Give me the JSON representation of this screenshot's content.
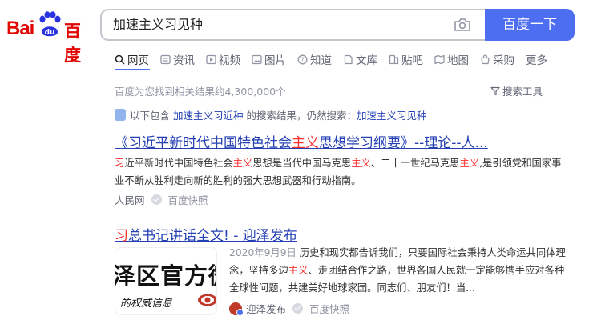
{
  "logo": {
    "latin": "Bai",
    "chinese": "百度"
  },
  "search": {
    "query": "加速主义习见种",
    "button_label": "百度一下"
  },
  "tabs": [
    {
      "label": "网页",
      "icon": "search-icon",
      "active": true
    },
    {
      "label": "资讯",
      "icon": "news-icon"
    },
    {
      "label": "视频",
      "icon": "video-icon"
    },
    {
      "label": "图片",
      "icon": "image-icon"
    },
    {
      "label": "知道",
      "icon": "question-icon"
    },
    {
      "label": "文库",
      "icon": "document-icon"
    },
    {
      "label": "贴吧",
      "icon": "tieba-icon"
    },
    {
      "label": "地图",
      "icon": "map-icon"
    },
    {
      "label": "采购",
      "icon": "shopping-icon"
    },
    {
      "label": "更多",
      "icon": ""
    }
  ],
  "results_info": {
    "count_text": "百度为您找到相关结果约4,300,000个",
    "tools_label": "搜索工具"
  },
  "correction": {
    "prefix": "以下包含",
    "corrected_query": "加速主义习近种",
    "middle": "的搜索结果，仍然搜索：",
    "original_query": "加速主义习见种"
  },
  "results": [
    {
      "title_parts": [
        "《习近平新时代中国特色社会",
        "主义",
        "思想学习纲要》--理论--人..."
      ],
      "abstract_parts": [
        "习",
        "近平新时代中国特色社会",
        "主义",
        "思想是当代中国马克思",
        "主义",
        "、二十一世纪马克思",
        "主义",
        ",是引领党和国家事业不断从胜利走向新的胜利的强大思想武器和行动指南。"
      ],
      "source": "人民网",
      "snapshot": "百度快照"
    },
    {
      "title_parts": [
        "习",
        "总书记讲话全文! - 迎泽发布"
      ],
      "date": "2020年9月9日",
      "abstract_parts": [
        "历史和现实都告诉我们，只要国际社会秉持人类命运共同体理念，坚持多边",
        "主义",
        "、走团结合作之路，世界各国人民就一定能够携手应对各种全球性问题，共建美好地球家园。同志们、朋友们！当..."
      ],
      "thumbnail_big_text": "泽区官方微",
      "thumbnail_small_text": "的权威信息",
      "source": "迎泽发布",
      "snapshot": "百度快照"
    }
  ],
  "colors": {
    "brand_red": "#e10601",
    "button_blue": "#4e6ef2",
    "link_blue": "#2440b3",
    "highlight_red": "#f73131"
  }
}
